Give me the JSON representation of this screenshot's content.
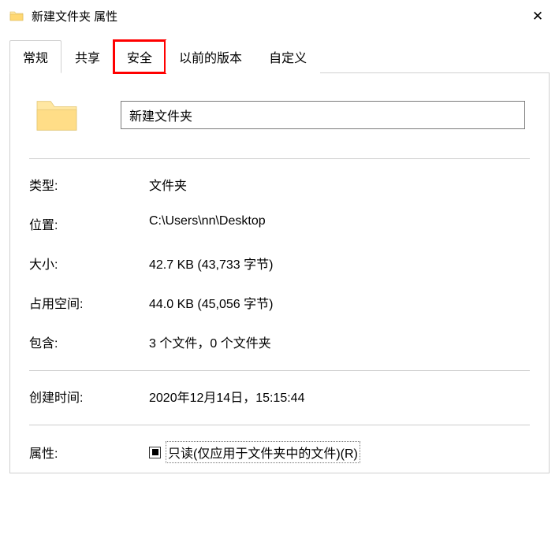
{
  "title": "新建文件夹 属性",
  "tabs": {
    "general": "常规",
    "sharing": "共享",
    "security": "安全",
    "prev_versions": "以前的版本",
    "custom": "自定义"
  },
  "folder_name": "新建文件夹",
  "labels": {
    "type": "类型:",
    "location": "位置:",
    "size": "大小:",
    "size_on_disk": "占用空间:",
    "contains": "包含:",
    "created": "创建时间:",
    "attributes": "属性:"
  },
  "values": {
    "type": "文件夹",
    "location": "C:\\Users\\nn\\Desktop",
    "size": "42.7 KB (43,733 字节)",
    "size_on_disk": "44.0 KB (45,056 字节)",
    "contains": "3 个文件，0 个文件夹",
    "created": "2020年12月14日，15:15:44"
  },
  "readonly_label": "只读(仅应用于文件夹中的文件)(R)"
}
